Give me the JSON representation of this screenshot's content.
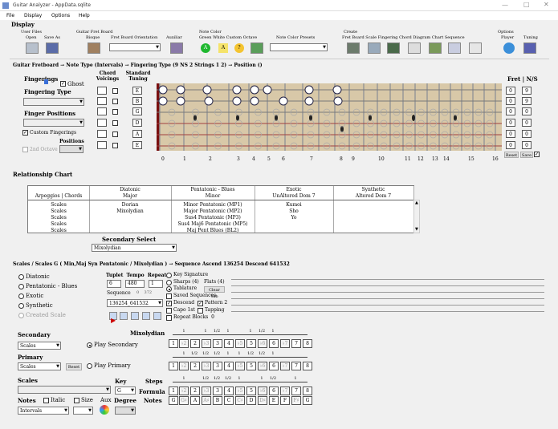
{
  "titlebar": {
    "title": "Guitar Analyzer - AppData.sqlite"
  },
  "menu": [
    "File",
    "Display",
    "Options",
    "Help"
  ],
  "display": {
    "label": "Display",
    "user_files": "User Files",
    "open": "Open",
    "save_as": "Save As",
    "guitar_fret_board": "Guitar Fret Board",
    "bisque": "Bisque",
    "fret_board_orientation": "Fret Board Orientation",
    "auxiliar": "Auxiliar",
    "note_color": "Note Color",
    "note_color_opts": "Green White Custom Octave",
    "note_color_presets": "Note Color Presets",
    "create": "Create",
    "create_items": [
      "Fret Board",
      "Scale",
      "Fingering",
      "Chord",
      "Diagram",
      "Chart",
      "Sequence"
    ],
    "options": "Options",
    "player": "Player",
    "tuning": "Tuning",
    "color_chips": [
      "A",
      "A",
      "?"
    ]
  },
  "breadcrumb": "Guitar Fretboard  →  Note Type (Intervals)  →  Fingering Type (9 NS 2 Strings 1 2)  →  Position  ()",
  "fingerings": {
    "title": "Fingerings",
    "ghost": "Ghost",
    "fingering_type": "Fingering Type",
    "finger_positions": "Finger Positions",
    "custom_fingerings": "Custom Fingerings",
    "positions": "Positions",
    "second_octave": "2nd Octave",
    "chord_voicings": "Chord Voicings",
    "standard_tuning": "Standard Tuning",
    "tuning": [
      "E",
      "B",
      "G",
      "D",
      "A",
      "E"
    ]
  },
  "fret_ns": {
    "label": "Fret | N/S",
    "rows": [
      [
        "0",
        "9"
      ],
      [
        "0",
        "9"
      ],
      [
        "0",
        "0"
      ],
      [
        "0",
        "0"
      ],
      [
        "0",
        "0"
      ],
      [
        "0",
        "0"
      ]
    ],
    "reset": "Reset",
    "save": "Save"
  },
  "fret_numbers": [
    "0",
    "1",
    "2",
    "3",
    "4",
    "5",
    "6",
    "7",
    "8",
    "9",
    "10",
    "11",
    "12",
    "13",
    "14",
    "15",
    "16"
  ],
  "relationship": {
    "title": "Relationship Chart",
    "headers": [
      [
        "Diatonic",
        "Pentatonic - Blues",
        "Exotic",
        "Synthetic"
      ],
      [
        "Arpeggios | Chords",
        "Major",
        "Minor",
        "UnAltered Dom 7",
        "Altered Dom 7"
      ]
    ],
    "rows": [
      [
        "Scales",
        "Dorian",
        "Minor Pentatonic (MP1)",
        "Kumoi",
        ""
      ],
      [
        "Scales",
        "Mixolydian",
        "Major Pentatonic (MP2)",
        "Sho",
        ""
      ],
      [
        "Scales",
        "",
        "Sus4 Pentatonic (MP3)",
        "Yo",
        ""
      ],
      [
        "Scales",
        "",
        "Sus4 Maj6 Pentatonic (MP5)",
        "",
        ""
      ],
      [
        "Scales",
        "",
        "Maj Pent Blues (BL2)",
        "",
        ""
      ]
    ],
    "secondary_select": "Secondary Select",
    "secondary_value": "Mixolydian"
  },
  "scales_header": "Scales / Scales   G  ( Min,Maj Syn Pentatonic  / Mixolydian )  →  Sequence  Ascend 136254  Descend 641532",
  "scale_types": [
    "Diatonic",
    "Pentatonic - Blues",
    "Exotic",
    "Synthetic",
    "Created Scale"
  ],
  "controls": {
    "tuplet_tempo_repeat": "Tuplet  Tempo  Repeat",
    "tuplet": "6",
    "tempo": "480",
    "repeat": "1",
    "sequence_label": "Sequence",
    "seq_count": "0    372",
    "sequence_value": "136254_641532",
    "key_signature": "Key Signature",
    "sharps": "Sharps (4)",
    "flats": "Flats (4)",
    "tablature": "Tablature",
    "clear_tab": "Clear Tab",
    "saved_sequences": "Saved Sequences",
    "descend": "Descend",
    "pattern2": "Pattern 2",
    "capo": "Capo 1st",
    "tapping": "Tapping",
    "repeat_blocks": "Repeat Blocks  0"
  },
  "secondary": {
    "label": "Secondary",
    "value": "Scales",
    "play": "Play Secondary",
    "name": "Mixolydian",
    "steps": [
      "1",
      "",
      "1",
      "1/2",
      "1",
      "",
      "1",
      "1/2",
      "1"
    ],
    "degrees": [
      "1",
      "♭2",
      "2",
      "♭3",
      "3",
      "4",
      "♭5",
      "5",
      "♭6",
      "6",
      "♭7",
      "7",
      "8"
    ]
  },
  "primary": {
    "label": "Primary",
    "value": "Scales",
    "reset": "Reset",
    "play": "Play Primary",
    "steps": [
      "1",
      "1/2",
      "1/2",
      "1/2",
      "1",
      "1",
      "1/2",
      "1/2",
      "1"
    ],
    "degrees": [
      "1",
      "♭2",
      "2",
      "♭3",
      "3",
      "4",
      "♭5",
      "5",
      "♭6",
      "6",
      "♭7",
      "7",
      "8"
    ]
  },
  "scales_bottom": {
    "label": "Scales",
    "notes": "Notes",
    "italic": "Italic",
    "size": "Size",
    "aux": "Aux",
    "notes_value": "Intervals",
    "key": "Key",
    "key_value": "G",
    "steps": "Steps",
    "formula": "Formula",
    "degree": "Degree",
    "notes2": "Notes",
    "steps_row": [
      "1",
      "",
      "1/2",
      "1/2",
      "1/2",
      "1",
      "",
      "1",
      "1/2",
      "",
      "1"
    ],
    "formula_row": [
      "1",
      "♭2",
      "2",
      "♭3",
      "3",
      "4",
      "♭5",
      "5",
      "♭6",
      "6",
      "♭7",
      "7",
      "8"
    ],
    "notes_row": [
      "G",
      "G♯",
      "A",
      "A♯",
      "B",
      "C",
      "C♯",
      "D",
      "D♯",
      "E",
      "F",
      "F♯",
      "G"
    ]
  }
}
